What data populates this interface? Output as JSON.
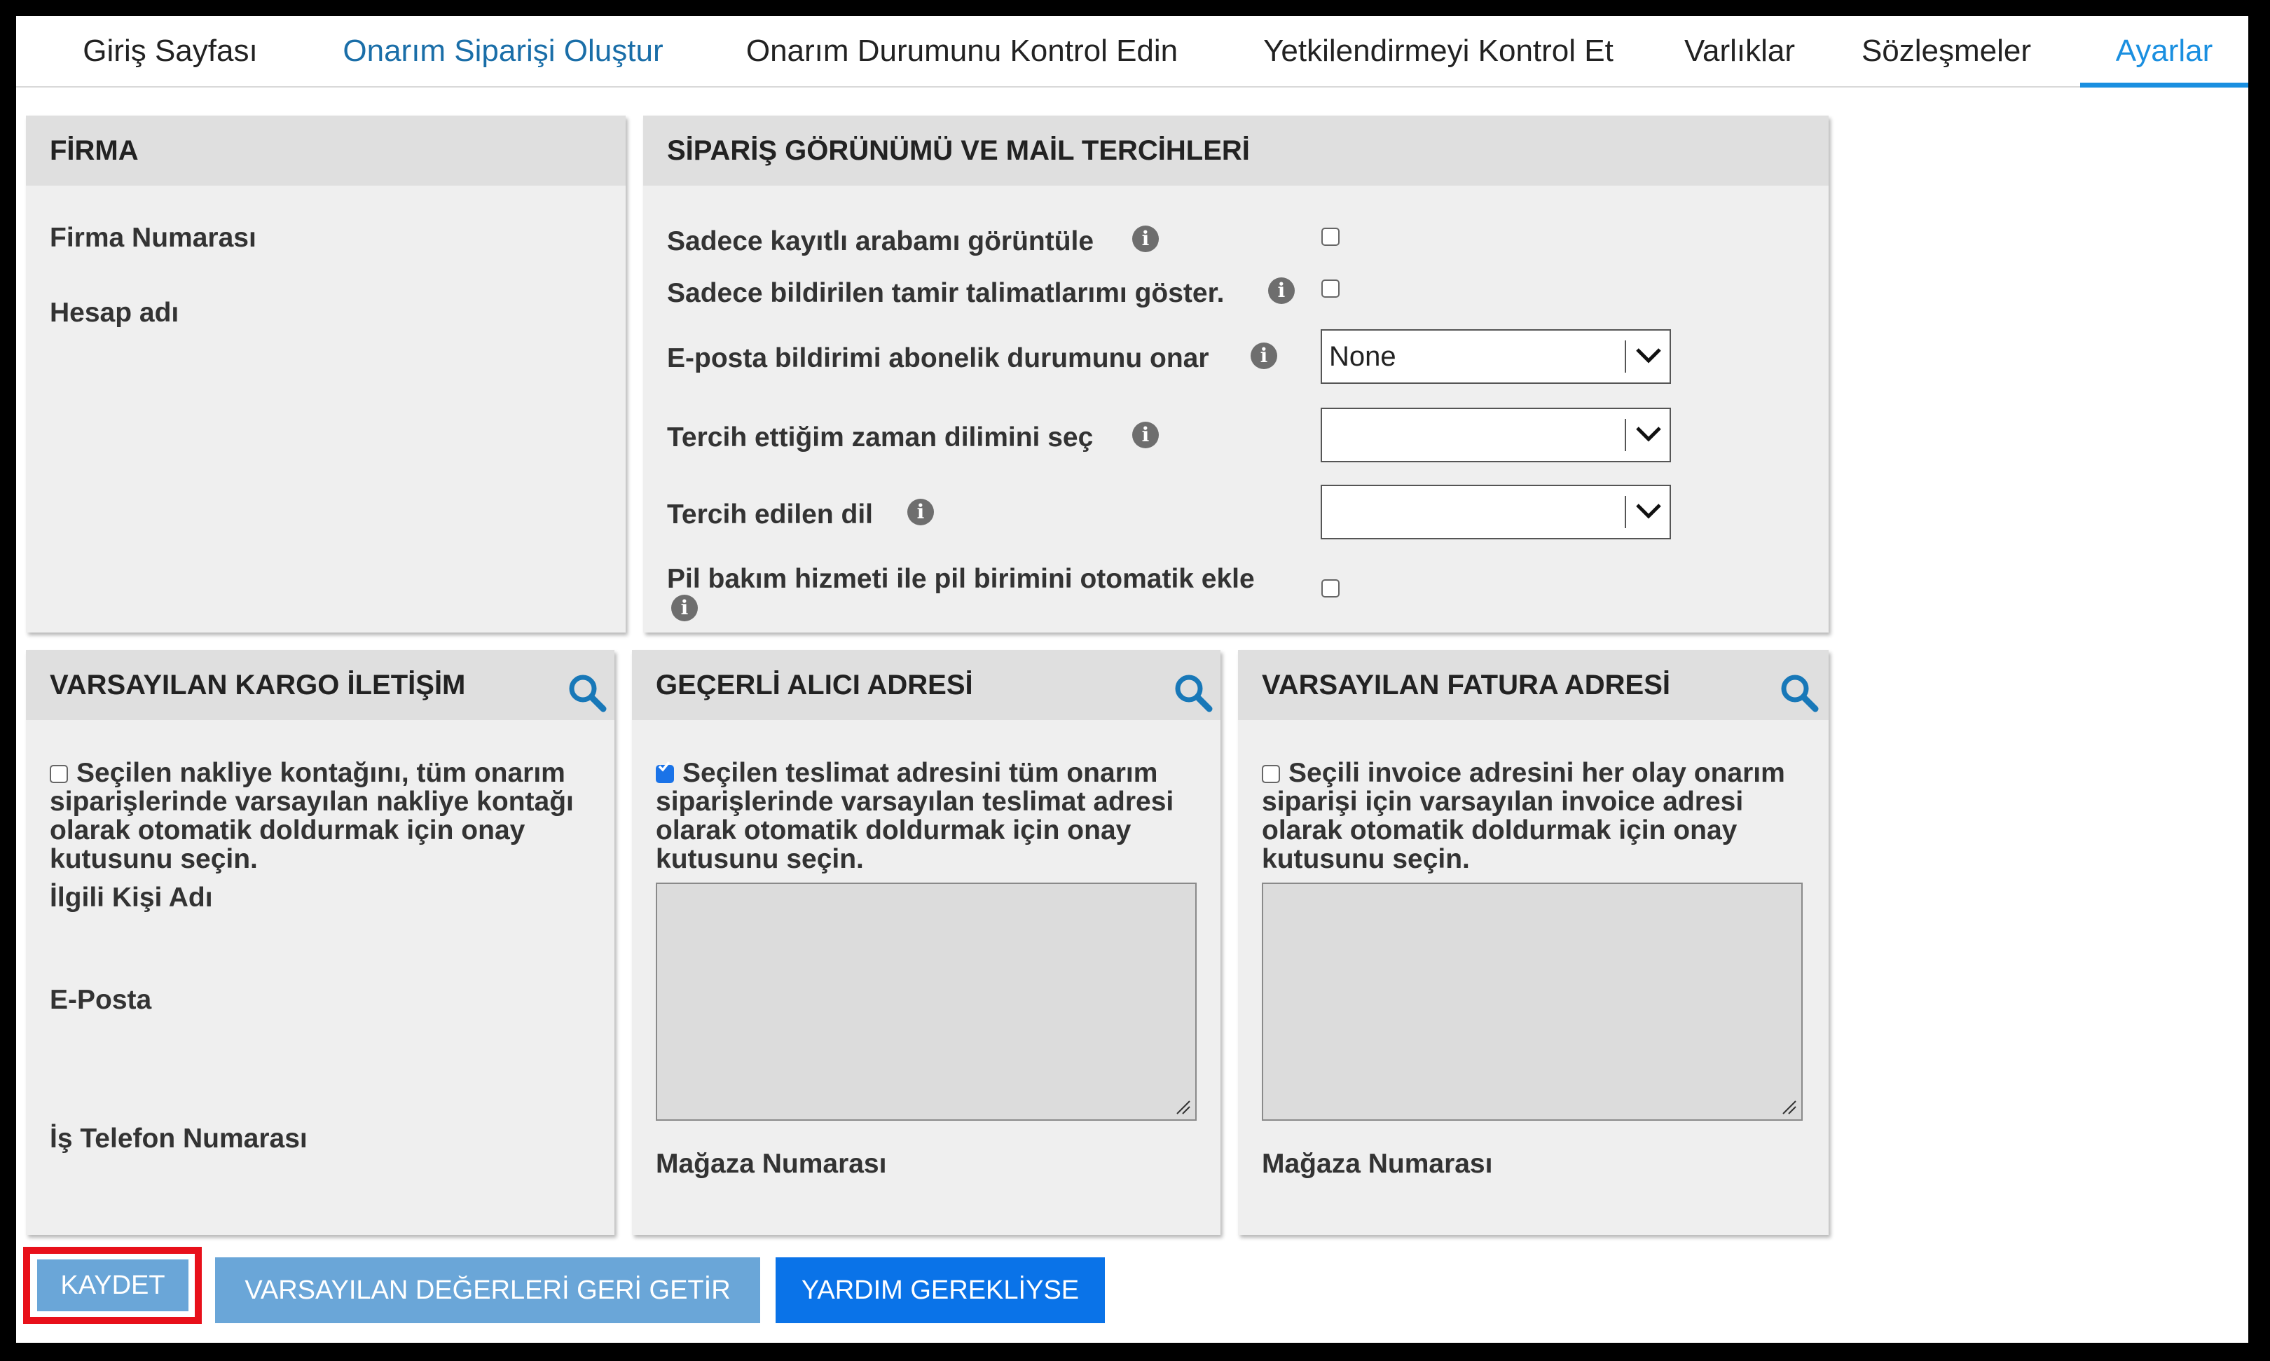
{
  "nav": {
    "tabs": [
      {
        "label": "Giriş Sayfası"
      },
      {
        "label": "Onarım Siparişi Oluştur"
      },
      {
        "label": "Onarım Durumunu Kontrol Edin"
      },
      {
        "label": "Yetkilendirmeyi Kontrol Et"
      },
      {
        "label": "Varlıklar"
      },
      {
        "label": "Sözleşmeler"
      },
      {
        "label": "Ayarlar"
      }
    ],
    "active_tab": "Ayarlar"
  },
  "firma": {
    "title": "FİRMA",
    "firma_numarasi": "Firma Numarası",
    "hesap_adi": "Hesap adı"
  },
  "siparis": {
    "title": "SİPARİŞ GÖRÜNÜMÜ VE MAİL TERCİHLERİ",
    "opt_kayitli_araba": {
      "label": "Sadece kayıtlı arabamı görüntüle",
      "checked": false
    },
    "opt_tamir_talimat": {
      "label": "Sadece bildirilen tamir talimatlarımı göster.",
      "checked": false
    },
    "eposta_bildirim": {
      "label": "E-posta bildirimi abonelik durumunu onar",
      "value": "None"
    },
    "zaman_dilimi": {
      "label": "Tercih ettiğim zaman dilimini seç",
      "value": ""
    },
    "dil": {
      "label": "Tercih edilen dil",
      "value": ""
    },
    "pil_bakim": {
      "label": "Pil bakım hizmeti ile pil birimini otomatik ekle",
      "checked": false
    }
  },
  "kargo": {
    "title": "VARSAYILAN KARGO İLETİŞİM",
    "checkbox_text": "Seçilen nakliye kontağını, tüm onarım siparişlerinde varsayılan nakliye kontağı olarak otomatik doldurmak için onay kutusunu seçin.",
    "checked": false,
    "ilgili_kisi": "İlgili Kişi Adı",
    "eposta": "E-Posta",
    "is_telefon": "İş Telefon Numarası"
  },
  "alici": {
    "title": "GEÇERLİ ALICI ADRESİ",
    "checkbox_text": "Seçilen teslimat adresini tüm onarım siparişlerinde varsayılan teslimat adresi olarak otomatik doldurmak için onay kutusunu seçin.",
    "checked": true,
    "magaza": "Mağaza Numarası"
  },
  "fatura": {
    "title": "VARSAYILAN FATURA ADRESİ",
    "checkbox_text": "Seçili invoice adresini her olay onarım siparişi için varsayılan invoice adresi olarak otomatik doldurmak için onay kutusunu seçin.",
    "checked": false,
    "magaza": "Mağaza Numarası"
  },
  "actions": {
    "save": "KAYDET",
    "reset": "VARSAYILAN DEĞERLERİ GERİ GETİR",
    "help": "YARDIM GEREKLİYSE"
  },
  "icons": {
    "info": "info-icon",
    "search": "search-icon",
    "dropdown": "chevron-down-icon"
  },
  "colors": {
    "active_tab": "#1a8fe0",
    "link_tab": "#1a6ea8",
    "primary_button": "#0a73e8",
    "secondary_button": "#6aa6d8",
    "highlight": "#e8101a",
    "search_icon": "#1878b8"
  }
}
